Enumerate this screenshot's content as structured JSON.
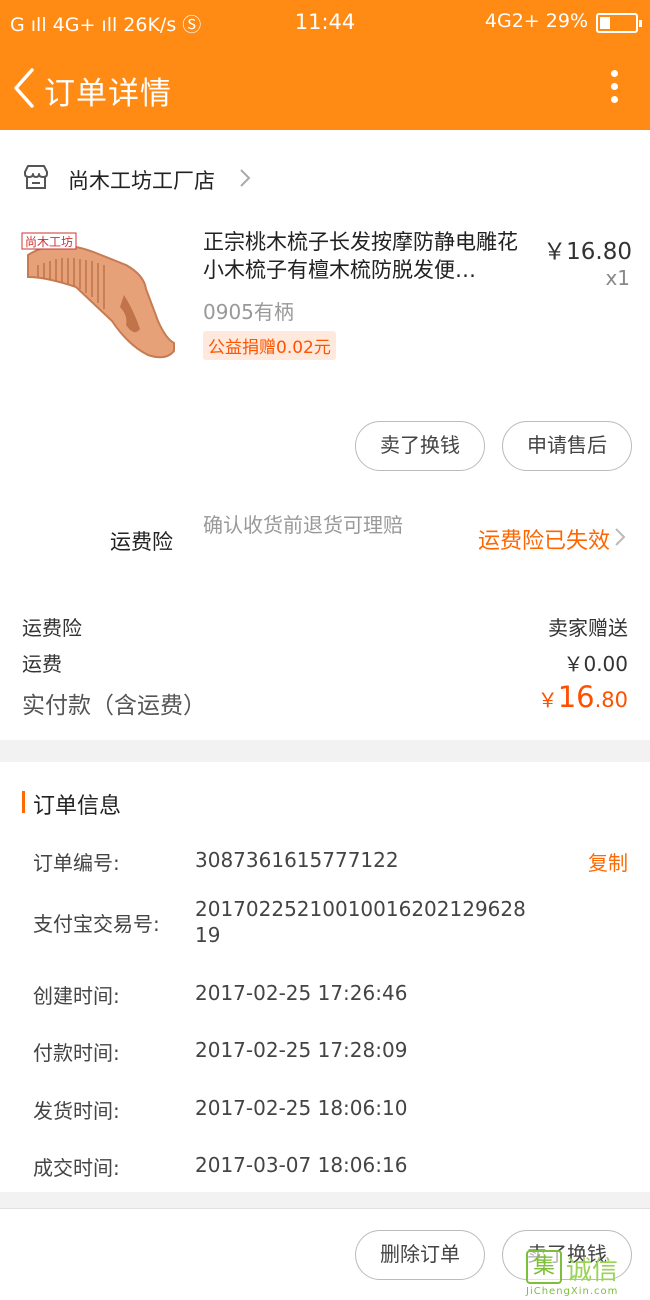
{
  "status_bar": {
    "left": "G ıll 4G+ ıll 26K/s Ⓢ",
    "time": "11:44",
    "right": "4G2+ 29%",
    "battery_level": 0.29
  },
  "header": {
    "title": "订单详情",
    "back_icon": "chevron-left-icon",
    "more_icon": "more-vertical-icon"
  },
  "shop": {
    "name": "尚木工坊工厂店",
    "icon": "store-icon"
  },
  "product": {
    "title": "正宗桃木梳子长发按摩防静电雕花小木梳子有檀木梳防脱发便…",
    "price": "￥16.80",
    "quantity": "x1",
    "sku": "0905有柄",
    "charity": "公益捐赠0.02元",
    "image_logo_text": "尚木工坊"
  },
  "actions": {
    "sell_label": "卖了换钱",
    "aftersale_label": "申请售后"
  },
  "insurance": {
    "label": "运费险",
    "desc": "确认收货前退货可理赔",
    "status": "运费险已失效"
  },
  "fees": {
    "insurance_label": "运费险",
    "insurance_value": "卖家赠送",
    "shipping_label": "运费",
    "shipping_value": "￥0.00",
    "total_label": "实付款（含运费）",
    "total_symbol": "￥",
    "total_int": "16",
    "total_dec": ".80"
  },
  "order_info": {
    "title": "订单信息",
    "copy_label": "复制",
    "rows": [
      {
        "key": "订单编号:",
        "value": "3087361615777122"
      },
      {
        "key": "支付宝交易号:",
        "value": "2017022521001001620212962819"
      },
      {
        "key": "创建时间:",
        "value": "2017-02-25 17:26:46"
      },
      {
        "key": "付款时间:",
        "value": "2017-02-25 17:28:09"
      },
      {
        "key": "发货时间:",
        "value": "2017-02-25 18:06:10"
      },
      {
        "key": "成交时间:",
        "value": "2017-03-07 18:06:16"
      }
    ]
  },
  "bottom_bar": {
    "delete_label": "删除订单",
    "sell_label": "卖了换钱"
  },
  "watermark": {
    "glyph": "集",
    "text": "诚信",
    "sub": "JiChengXin.com"
  },
  "colors": {
    "brand": "#ff8a14",
    "accent": "#ff6a00",
    "price": "#ff5000"
  }
}
